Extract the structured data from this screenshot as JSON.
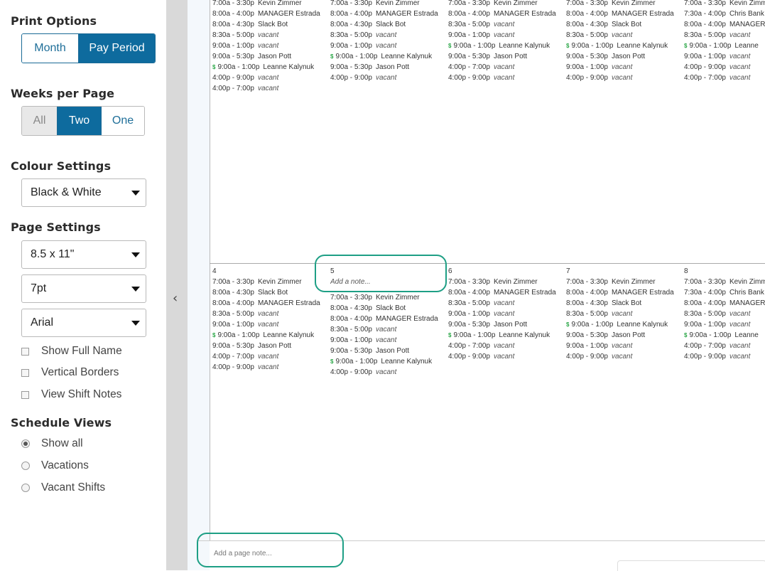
{
  "sidebar": {
    "print_options": {
      "title": "Print Options",
      "month": "Month",
      "pay_period": "Pay Period"
    },
    "weeks_per_page": {
      "title": "Weeks per Page",
      "all": "All",
      "two": "Two",
      "one": "One"
    },
    "colour_settings": {
      "title": "Colour Settings",
      "value": "Black & White"
    },
    "page_settings": {
      "title": "Page Settings",
      "paper": "8.5 x 11\"",
      "font_size": "7pt",
      "font": "Arial"
    },
    "checkboxes": [
      "Show Full Name",
      "Vertical Borders",
      "View Shift Notes"
    ],
    "schedule_views": {
      "title": "Schedule Views",
      "options": [
        "Show all",
        "Vacations",
        "Vacant Shifts"
      ],
      "selected": "Show all"
    }
  },
  "colors": {
    "accent": "#0e6b9e",
    "highlight": "#1e9f85",
    "dollar": "#2ea84a"
  },
  "week1": {
    "days": [
      {
        "num": "",
        "note": "",
        "shifts": [
          {
            "time": "7:00a - 3:30p",
            "emp": "Kevin Zimmer"
          },
          {
            "time": "8:00a - 4:00p",
            "emp": "MANAGER Estrada"
          },
          {
            "time": "8:00a - 4:30p",
            "emp": "Slack Bot"
          },
          {
            "time": "8:30a - 5:00p",
            "emp": "vacant",
            "vacant": true
          },
          {
            "time": "9:00a - 1:00p",
            "emp": "vacant",
            "vacant": true
          },
          {
            "time": "9:00a - 5:30p",
            "emp": "Jason Pott"
          },
          {
            "time": "9:00a - 1:00p",
            "emp": "Leanne Kalynuk",
            "dollar": true
          },
          {
            "time": "4:00p - 9:00p",
            "emp": "vacant",
            "vacant": true
          },
          {
            "time": "4:00p - 7:00p",
            "emp": "vacant",
            "vacant": true
          }
        ]
      },
      {
        "num": "",
        "note": "",
        "shifts": [
          {
            "time": "7:00a - 3:30p",
            "emp": "Kevin Zimmer"
          },
          {
            "time": "8:00a - 4:00p",
            "emp": "MANAGER Estrada"
          },
          {
            "time": "8:00a - 4:30p",
            "emp": "Slack Bot"
          },
          {
            "time": "8:30a - 5:00p",
            "emp": "vacant",
            "vacant": true
          },
          {
            "time": "9:00a - 1:00p",
            "emp": "vacant",
            "vacant": true
          },
          {
            "time": "9:00a - 1:00p",
            "emp": "Leanne Kalynuk",
            "dollar": true
          },
          {
            "time": "9:00a - 5:30p",
            "emp": "Jason Pott"
          },
          {
            "time": "4:00p - 9:00p",
            "emp": "vacant",
            "vacant": true
          }
        ]
      },
      {
        "num": "",
        "note": "",
        "shifts": [
          {
            "time": "7:00a - 3:30p",
            "emp": "Kevin Zimmer"
          },
          {
            "time": "8:00a - 4:00p",
            "emp": "MANAGER Estrada"
          },
          {
            "time": "8:30a - 5:00p",
            "emp": "vacant",
            "vacant": true
          },
          {
            "time": "9:00a - 1:00p",
            "emp": "vacant",
            "vacant": true
          },
          {
            "time": "9:00a - 1:00p",
            "emp": "Leanne Kalynuk",
            "dollar": true
          },
          {
            "time": "9:00a - 5:30p",
            "emp": "Jason Pott"
          },
          {
            "time": "4:00p - 7:00p",
            "emp": "vacant",
            "vacant": true
          },
          {
            "time": "4:00p - 9:00p",
            "emp": "vacant",
            "vacant": true
          }
        ]
      },
      {
        "num": "",
        "note": "",
        "shifts": [
          {
            "time": "7:00a - 3:30p",
            "emp": "Kevin Zimmer"
          },
          {
            "time": "8:00a - 4:00p",
            "emp": "MANAGER Estrada"
          },
          {
            "time": "8:00a - 4:30p",
            "emp": "Slack Bot"
          },
          {
            "time": "8:30a - 5:00p",
            "emp": "vacant",
            "vacant": true
          },
          {
            "time": "9:00a - 1:00p",
            "emp": "Leanne Kalynuk",
            "dollar": true
          },
          {
            "time": "9:00a - 5:30p",
            "emp": "Jason Pott"
          },
          {
            "time": "9:00a - 1:00p",
            "emp": "vacant",
            "vacant": true
          },
          {
            "time": "4:00p - 9:00p",
            "emp": "vacant",
            "vacant": true
          }
        ]
      },
      {
        "num": "",
        "note": "",
        "shifts": [
          {
            "time": "7:00a - 3:30p",
            "emp": "Kevin Zimm"
          },
          {
            "time": "7:30a - 4:00p",
            "emp": "Chris Bank"
          },
          {
            "time": "8:00a - 4:00p",
            "emp": "MANAGER"
          },
          {
            "time": "8:30a - 5:00p",
            "emp": "vacant",
            "vacant": true
          },
          {
            "time": "9:00a - 1:00p",
            "emp": "Leanne",
            "dollar": true
          },
          {
            "time": "9:00a - 1:00p",
            "emp": "vacant",
            "vacant": true
          },
          {
            "time": "4:00p - 9:00p",
            "emp": "vacant",
            "vacant": true
          },
          {
            "time": "4:00p - 7:00p",
            "emp": "vacant",
            "vacant": true
          }
        ]
      }
    ]
  },
  "week2": {
    "days": [
      {
        "num": "4",
        "note": "",
        "shifts": [
          {
            "time": "7:00a - 3:30p",
            "emp": "Kevin Zimmer"
          },
          {
            "time": "8:00a - 4:30p",
            "emp": "Slack Bot"
          },
          {
            "time": "8:00a - 4:00p",
            "emp": "MANAGER Estrada"
          },
          {
            "time": "8:30a - 5:00p",
            "emp": "vacant",
            "vacant": true
          },
          {
            "time": "9:00a - 1:00p",
            "emp": "vacant",
            "vacant": true
          },
          {
            "time": "9:00a - 1:00p",
            "emp": "Leanne Kalynuk",
            "dollar": true
          },
          {
            "time": "9:00a - 5:30p",
            "emp": "Jason Pott"
          },
          {
            "time": "4:00p - 7:00p",
            "emp": "vacant",
            "vacant": true
          },
          {
            "time": "4:00p - 9:00p",
            "emp": "vacant",
            "vacant": true
          }
        ]
      },
      {
        "num": "5",
        "note": "Add a note...",
        "shifts": [
          {
            "time": "7:00a - 3:30p",
            "emp": "Kevin Zimmer"
          },
          {
            "time": "8:00a - 4:30p",
            "emp": "Slack Bot"
          },
          {
            "time": "8:00a - 4:00p",
            "emp": "MANAGER Estrada"
          },
          {
            "time": "8:30a - 5:00p",
            "emp": "vacant",
            "vacant": true
          },
          {
            "time": "9:00a - 1:00p",
            "emp": "vacant",
            "vacant": true
          },
          {
            "time": "9:00a - 5:30p",
            "emp": "Jason Pott"
          },
          {
            "time": "9:00a - 1:00p",
            "emp": "Leanne Kalynuk",
            "dollar": true
          },
          {
            "time": "4:00p - 9:00p",
            "emp": "vacant",
            "vacant": true
          }
        ]
      },
      {
        "num": "6",
        "note": "",
        "shifts": [
          {
            "time": "7:00a - 3:30p",
            "emp": "Kevin Zimmer"
          },
          {
            "time": "8:00a - 4:00p",
            "emp": "MANAGER Estrada"
          },
          {
            "time": "8:30a - 5:00p",
            "emp": "vacant",
            "vacant": true
          },
          {
            "time": "9:00a - 1:00p",
            "emp": "vacant",
            "vacant": true
          },
          {
            "time": "9:00a - 5:30p",
            "emp": "Jason Pott"
          },
          {
            "time": "9:00a - 1:00p",
            "emp": "Leanne Kalynuk",
            "dollar": true
          },
          {
            "time": "4:00p - 7:00p",
            "emp": "vacant",
            "vacant": true
          },
          {
            "time": "4:00p - 9:00p",
            "emp": "vacant",
            "vacant": true
          }
        ]
      },
      {
        "num": "7",
        "note": "",
        "shifts": [
          {
            "time": "7:00a - 3:30p",
            "emp": "Kevin Zimmer"
          },
          {
            "time": "8:00a - 4:00p",
            "emp": "MANAGER Estrada"
          },
          {
            "time": "8:00a - 4:30p",
            "emp": "Slack Bot"
          },
          {
            "time": "8:30a - 5:00p",
            "emp": "vacant",
            "vacant": true
          },
          {
            "time": "9:00a - 1:00p",
            "emp": "Leanne Kalynuk",
            "dollar": true
          },
          {
            "time": "9:00a - 5:30p",
            "emp": "Jason Pott"
          },
          {
            "time": "9:00a - 1:00p",
            "emp": "vacant",
            "vacant": true
          },
          {
            "time": "4:00p - 9:00p",
            "emp": "vacant",
            "vacant": true
          }
        ]
      },
      {
        "num": "8",
        "note": "",
        "shifts": [
          {
            "time": "7:00a - 3:30p",
            "emp": "Kevin Zimm"
          },
          {
            "time": "7:30a - 4:00p",
            "emp": "Chris Bank"
          },
          {
            "time": "8:00a - 4:00p",
            "emp": "MANAGER"
          },
          {
            "time": "8:30a - 5:00p",
            "emp": "vacant",
            "vacant": true
          },
          {
            "time": "9:00a - 1:00p",
            "emp": "vacant",
            "vacant": true
          },
          {
            "time": "9:00a - 1:00p",
            "emp": "Leanne",
            "dollar": true
          },
          {
            "time": "4:00p - 7:00p",
            "emp": "vacant",
            "vacant": true
          },
          {
            "time": "4:00p - 9:00p",
            "emp": "vacant",
            "vacant": true
          }
        ]
      }
    ]
  },
  "page_note": {
    "placeholder": "Add a page note..."
  },
  "icons": {
    "collapse": "chevron-left-icon",
    "dollar": "dollar-icon"
  }
}
